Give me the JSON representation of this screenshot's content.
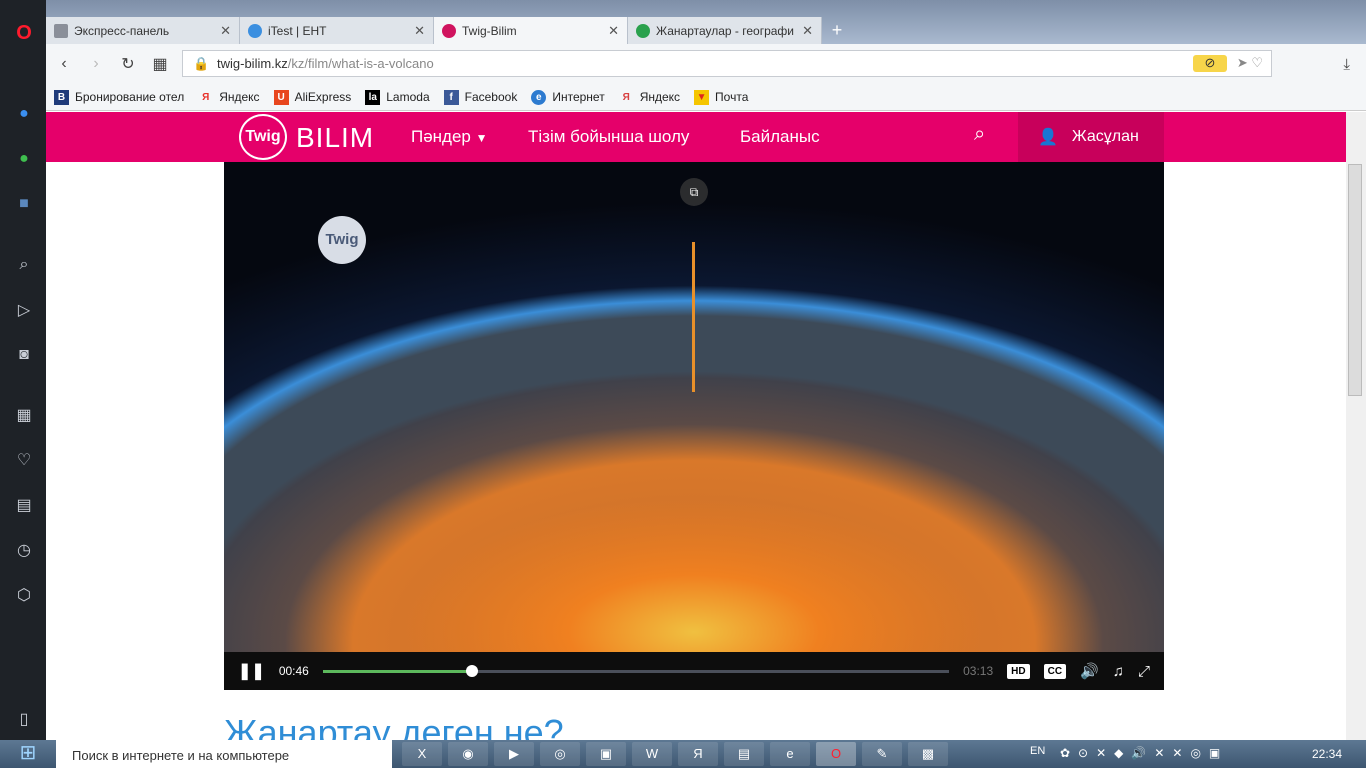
{
  "tabs": [
    {
      "label": "Экспресс-панель",
      "color": "#8a8f99"
    },
    {
      "label": "iTest | ЕНТ",
      "color": "#3b8fe0"
    },
    {
      "label": "Twig-Bilim",
      "color": "#d0145f"
    },
    {
      "label": "Жанартаулар - географи",
      "color": "#2aa14d"
    }
  ],
  "address": {
    "domain": "twig-bilim.kz",
    "path": "/kz/film/what-is-a-volcano"
  },
  "bookmarks": [
    {
      "label": "Бронирование отел",
      "icon": "B.",
      "color": "#1f3b7a"
    },
    {
      "label": "Яндекс",
      "icon": "Я",
      "color": "#e8322b"
    },
    {
      "label": "AliExpress",
      "icon": "U",
      "color": "#e8461e"
    },
    {
      "label": "Lamoda",
      "icon": "la",
      "color": "#000"
    },
    {
      "label": "Facebook",
      "icon": "f",
      "color": "#3b5998"
    },
    {
      "label": "Интернет",
      "icon": "e",
      "color": "#2d7bd0"
    },
    {
      "label": "Яндекс",
      "icon": "Я",
      "color": "#d84040"
    },
    {
      "label": "Почта",
      "icon": "✉",
      "color": "#f5c500"
    }
  ],
  "site": {
    "logo": "Twig",
    "brand": "BILIM",
    "menu": [
      "Пәндер",
      "Тізім бойынша шолу",
      "Байланыс"
    ],
    "user": "Жасұлан",
    "video_badge": "Twig"
  },
  "player": {
    "current": "00:46",
    "duration": "03:13",
    "progress": 0.238,
    "hd": "HD",
    "cc": "CC"
  },
  "heading": "Жанартау деген не?",
  "taskbar": {
    "search_placeholder": "Поиск в интернете и на компьютере",
    "lang": "EN",
    "time": "22:34"
  }
}
